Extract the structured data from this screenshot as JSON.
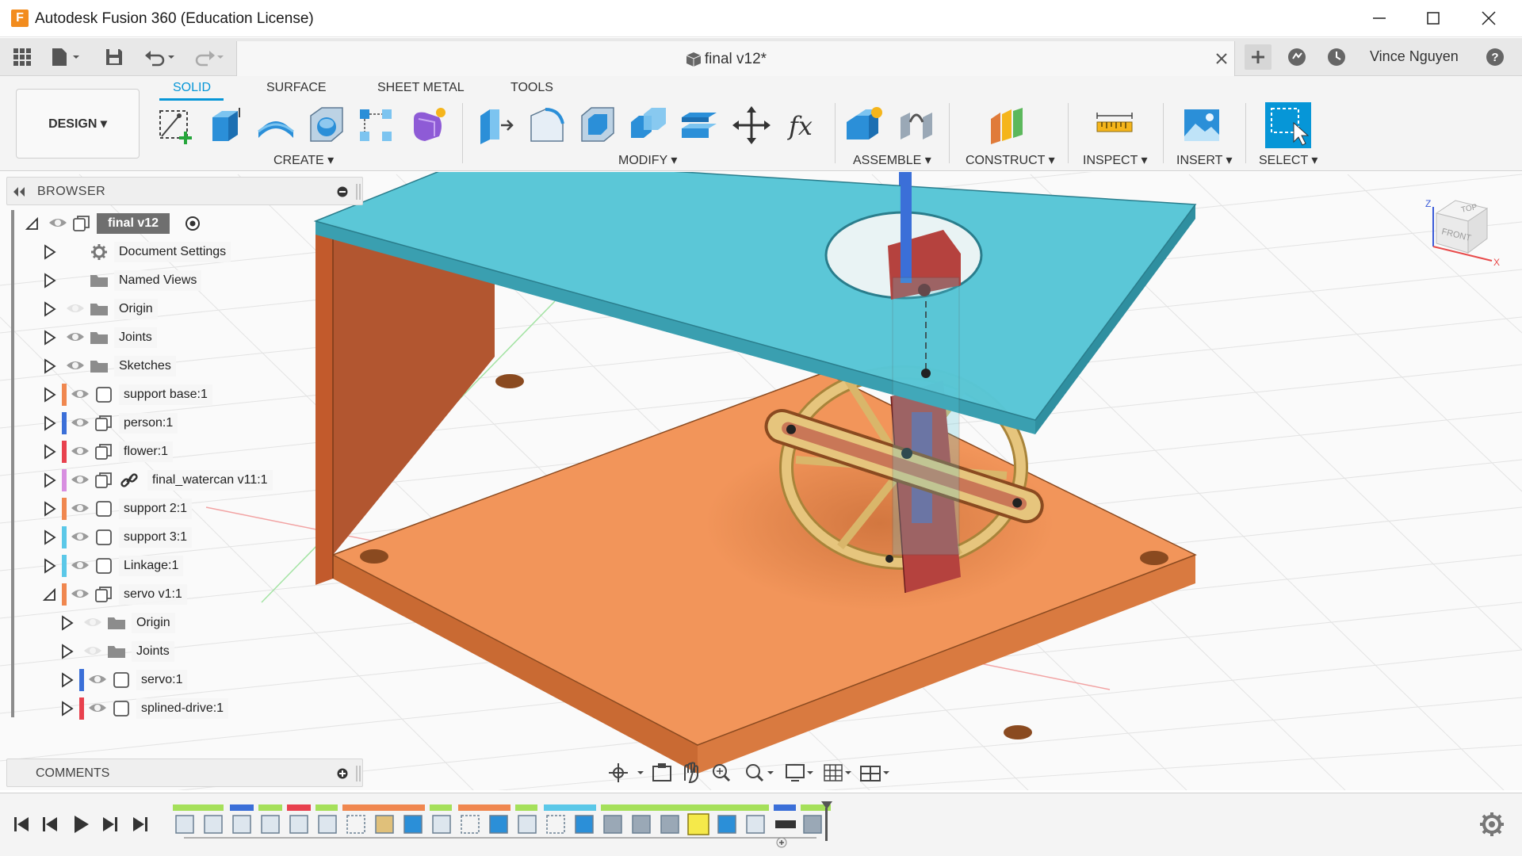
{
  "window": {
    "title": "Autodesk Fusion 360 (Education License)",
    "logo_letter": "F"
  },
  "topbar": {
    "document_title": "final v12*",
    "user_name": "Vince Nguyen"
  },
  "toolbar": {
    "workspace_label": "DESIGN",
    "tabs": [
      {
        "label": "SOLID",
        "active": true
      },
      {
        "label": "SURFACE",
        "active": false
      },
      {
        "label": "SHEET METAL",
        "active": false
      },
      {
        "label": "TOOLS",
        "active": false
      }
    ],
    "groups": {
      "create": "CREATE",
      "modify": "MODIFY",
      "assemble": "ASSEMBLE",
      "construct": "CONSTRUCT",
      "inspect": "INSPECT",
      "insert": "INSERT",
      "select": "SELECT"
    },
    "formula_glyph": "fx"
  },
  "browser": {
    "header_label": "BROWSER",
    "items": [
      {
        "label": "final v12",
        "icon": "component-icon",
        "depth": 0,
        "expanded": true,
        "color": ""
      },
      {
        "label": "Document Settings",
        "icon": "gear-icon",
        "depth": 1,
        "expanded": false,
        "color": ""
      },
      {
        "label": "Named Views",
        "icon": "folder-icon",
        "depth": 1,
        "expanded": false,
        "color": ""
      },
      {
        "label": "Origin",
        "icon": "folder-icon",
        "depth": 1,
        "expanded": false,
        "color": "",
        "hidden": true
      },
      {
        "label": "Joints",
        "icon": "folder-icon",
        "depth": 1,
        "expanded": false,
        "color": ""
      },
      {
        "label": "Sketches",
        "icon": "folder-icon",
        "depth": 1,
        "expanded": false,
        "color": ""
      },
      {
        "label": "support base:1",
        "icon": "body-icon",
        "depth": 1,
        "expanded": false,
        "color": "#f0874f"
      },
      {
        "label": "person:1",
        "icon": "component-icon",
        "depth": 1,
        "expanded": false,
        "color": "#3b6fd8"
      },
      {
        "label": "flower:1",
        "icon": "component-icon",
        "depth": 1,
        "expanded": false,
        "color": "#e8414e"
      },
      {
        "label": "final_watercan v11:1",
        "icon": "component-icon",
        "depth": 1,
        "expanded": false,
        "color": "#d88ee0",
        "linked": true
      },
      {
        "label": "support 2:1",
        "icon": "body-icon",
        "depth": 1,
        "expanded": false,
        "color": "#f0874f"
      },
      {
        "label": "support 3:1",
        "icon": "body-icon",
        "depth": 1,
        "expanded": false,
        "color": "#5bc8e8"
      },
      {
        "label": "Linkage:1",
        "icon": "body-icon",
        "depth": 1,
        "expanded": false,
        "color": "#5bc8e8"
      },
      {
        "label": "servo v1:1",
        "icon": "component-icon",
        "depth": 1,
        "expanded": true,
        "color": "#f0874f"
      },
      {
        "label": "Origin",
        "icon": "folder-icon",
        "depth": 2,
        "expanded": false,
        "color": "",
        "hidden": true
      },
      {
        "label": "Joints",
        "icon": "folder-icon",
        "depth": 2,
        "expanded": false,
        "color": "",
        "hidden": true
      },
      {
        "label": "servo:1",
        "icon": "body-icon",
        "depth": 2,
        "expanded": false,
        "color": "#3b6fd8"
      },
      {
        "label": "splined-drive:1",
        "icon": "body-icon",
        "depth": 2,
        "expanded": false,
        "color": "#e8414e"
      }
    ]
  },
  "comments": {
    "label": "COMMENTS"
  },
  "viewcube": {
    "top_label": "TOP",
    "front_label": "FRONT",
    "axis_z": "Z",
    "axis_x": "X"
  },
  "colors": {
    "accent": "#0696d7",
    "top_plate": "#58c6d6",
    "base_plate": "#f2955a",
    "wheel": "#e0c07a",
    "servo": "#b5423e"
  }
}
